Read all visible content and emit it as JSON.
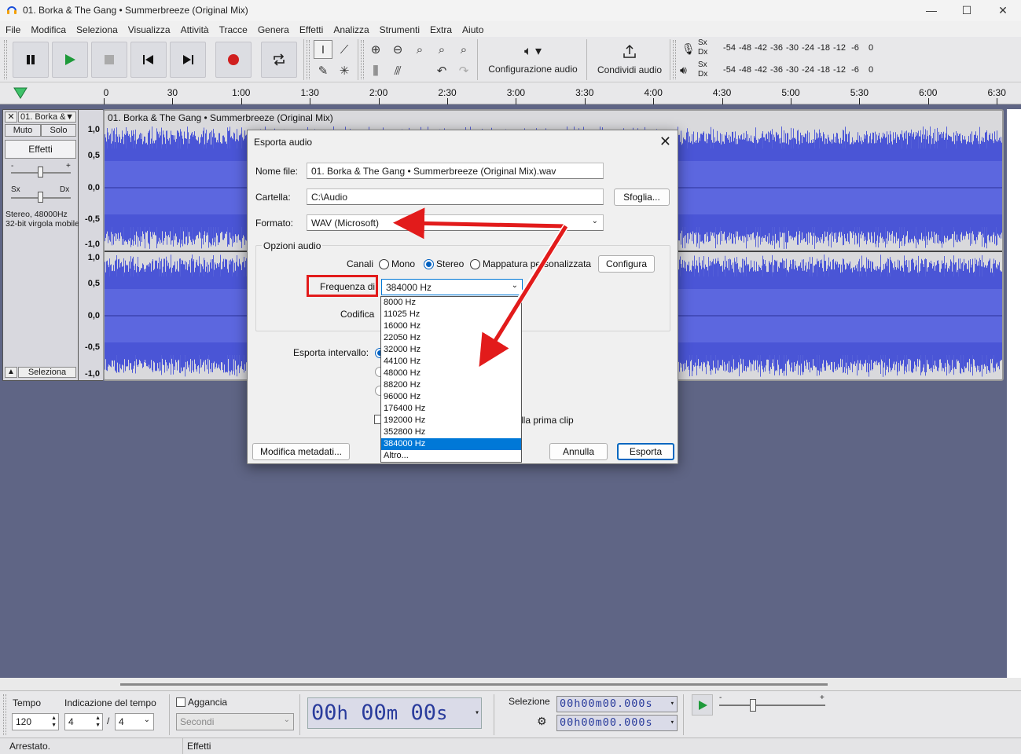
{
  "window": {
    "title": "01. Borka & The Gang • Summerbreeze (Original Mix)",
    "minimize": "—",
    "maximize": "☐",
    "close": "✕"
  },
  "menu": [
    "File",
    "Modifica",
    "Seleziona",
    "Visualizza",
    "Attività",
    "Tracce",
    "Genera",
    "Effetti",
    "Analizza",
    "Strumenti",
    "Extra",
    "Aiuto"
  ],
  "toolbar": {
    "audio_setup_label": "Configurazione audio",
    "share_audio_label": "Condividi audio",
    "meter_channels": [
      "Sx",
      "Dx"
    ],
    "meter_scale": [
      "-54",
      "-48",
      "-42",
      "-36",
      "-30",
      "-24",
      "-18",
      "-12",
      "-6",
      "0"
    ]
  },
  "ruler": {
    "ticks": [
      "0",
      "30",
      "1:00",
      "1:30",
      "2:00",
      "2:30",
      "3:00",
      "3:30",
      "4:00",
      "4:30",
      "5:00",
      "5:30",
      "6:00",
      "6:30"
    ]
  },
  "track": {
    "name": "01. Borka &",
    "clip_name": "01. Borka & The Gang • Summerbreeze (Original Mix)",
    "mute_label": "Muto",
    "solo_label": "Solo",
    "effects_label": "Effetti",
    "gain_min": "-",
    "gain_max": "+",
    "pan_left": "Sx",
    "pan_right": "Dx",
    "info_line1": "Stereo, 48000Hz",
    "info_line2": "32-bit virgola mobile",
    "select_label": "Seleziona",
    "vruler_ch1": [
      "1,0",
      "0,5",
      "0,0",
      "-0,5",
      "-1,0"
    ],
    "vruler_ch2": [
      "1,0",
      "0,5",
      "0,0",
      "-0,5",
      "-1,0"
    ],
    "wave_color": "#4a55d6"
  },
  "dialog": {
    "title": "Esporta audio",
    "filename_label": "Nome file:",
    "filename_value": "01. Borka & The Gang • Summerbreeze (Original Mix).wav",
    "folder_label": "Cartella:",
    "folder_value": "C:\\Audio",
    "browse_label": "Sfoglia...",
    "format_label": "Formato:",
    "format_value": "WAV (Microsoft)",
    "audio_options_label": "Opzioni audio",
    "channels_label": "Canali",
    "mono_label": "Mono",
    "stereo_label": "Stereo",
    "custom_mapping_label": "Mappatura personalizzata",
    "configure_label": "Configura",
    "sample_rate_label": "Frequenza di",
    "sample_rate_value": "384000 Hz",
    "encoding_label": "Codifica",
    "export_range_label": "Esporta intervallo:",
    "trim_label_partial": "lla prima clip",
    "metadata_label": "Modifica metadati...",
    "cancel_label": "Annulla",
    "export_label": "Esporta",
    "sample_rate_options": [
      "8000 Hz",
      "11025 Hz",
      "16000 Hz",
      "22050 Hz",
      "32000 Hz",
      "44100 Hz",
      "48000 Hz",
      "88200 Hz",
      "96000 Hz",
      "176400 Hz",
      "192000 Hz",
      "352800 Hz",
      "384000 Hz",
      "Altro..."
    ],
    "selected_option": "384000 Hz"
  },
  "bottom": {
    "tempo_label": "Tempo",
    "tempo_value": "120",
    "time_sig_label": "Indicazione del tempo",
    "time_sig_num": "4",
    "time_sig_sep": "/",
    "time_sig_den": "4",
    "snap_label": "Aggancia",
    "snap_unit": "Secondi",
    "time_display": [
      "00",
      "h",
      "00",
      "m",
      "00",
      "s"
    ],
    "selection_label": "Selezione",
    "sel_start": "00h00m00.000s",
    "sel_end": "00h00m00.000s",
    "speed_min": "-",
    "speed_max": "+"
  },
  "status": {
    "left": "Arrestato.",
    "right": "Effetti"
  },
  "colors": {
    "annotation_red": "#e21b1b",
    "selection_blue": "#0078d7",
    "project_bg": "#5f6585"
  }
}
